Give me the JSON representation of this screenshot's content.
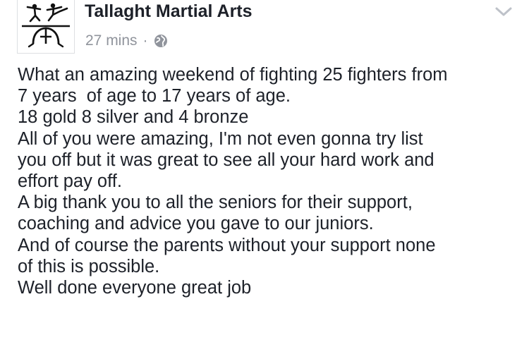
{
  "post": {
    "page_name": "Tallaght Martial Arts",
    "timestamp": "27 mins",
    "separator": "·",
    "privacy_icon": "globe-icon",
    "options_icon": "chevron-down-icon",
    "avatar_icon": "martial-arts-logo-icon",
    "lines": [
      "What an amazing weekend of fighting 25 fighters from",
      "7 years  of age to 17 years of age.",
      "18 gold 8 silver and 4 bronze",
      "All of you were amazing, I'm not even gonna try list",
      "you off but it was great to see all your hard work and",
      "effort pay off.",
      "A big thank you to all the seniors for their support,",
      "coaching and advice you gave to our juniors.",
      "And of course the parents without your support none",
      "of this is possible.",
      "Well done everyone great job"
    ]
  },
  "colors": {
    "text": "#1d2129",
    "meta": "#90949c",
    "logo": "#111111"
  }
}
